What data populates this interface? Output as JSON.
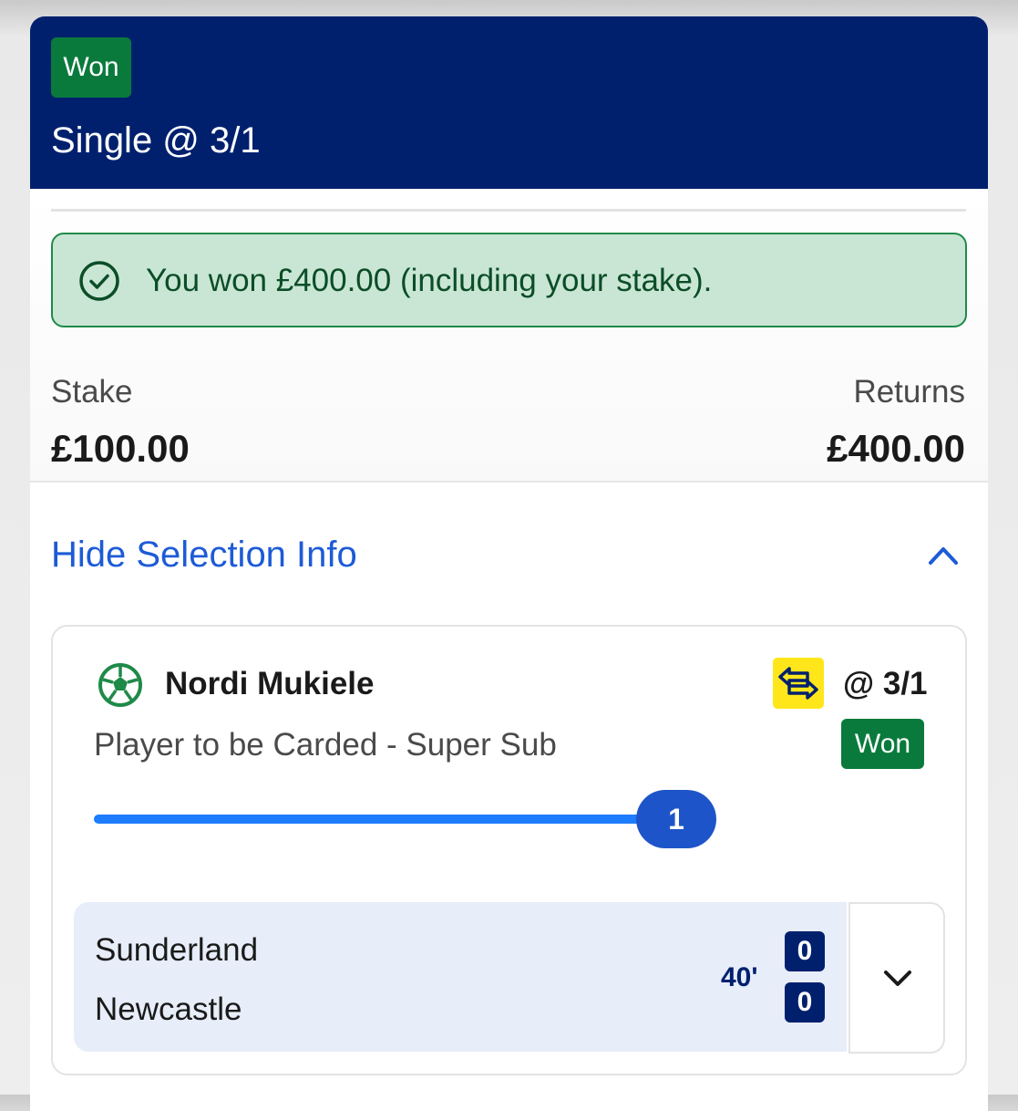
{
  "header": {
    "status_badge": "Won",
    "bet_title": "Single @ 3/1",
    "background_color": "#00206e"
  },
  "result": {
    "message": "You won £400.00 (including your stake).",
    "icon": "check-circle-icon"
  },
  "summary": {
    "stake_label": "Stake",
    "stake_value": "£100.00",
    "returns_label": "Returns",
    "returns_value": "£400.00"
  },
  "selection_toggle": {
    "label": "Hide Selection Info",
    "icon": "chevron-up-icon"
  },
  "selection": {
    "sport_icon": "football-icon",
    "player": "Nordi Mukiele",
    "boost_icon": "super-sub-swap-icon",
    "odds": "@ 3/1",
    "market": "Player to be Carded - Super Sub",
    "status_badge": "Won",
    "progress_count": "1",
    "progress_fraction": 1.0
  },
  "match": {
    "home_team": "Sunderland",
    "away_team": "Newcastle",
    "minute": "40'",
    "home_score": "0",
    "away_score": "0",
    "expand_icon": "chevron-down-icon"
  },
  "colors": {
    "won_green": "#0a7a3c",
    "link_blue": "#1d5bd6",
    "accent_yellow": "#ffe61a"
  }
}
